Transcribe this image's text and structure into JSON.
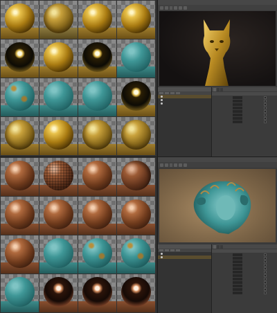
{
  "top_materials": [
    {
      "mat": "m-gold",
      "floor": "gold",
      "label": ""
    },
    {
      "mat": "m-goldr",
      "floor": "goldr",
      "label": ""
    },
    {
      "mat": "m-gold",
      "floor": "gold",
      "label": ""
    },
    {
      "mat": "m-gold",
      "floor": "gold",
      "label": ""
    },
    {
      "mat": "m-mirror",
      "floor": "gold",
      "label": ""
    },
    {
      "mat": "m-gold",
      "floor": "gold",
      "label": ""
    },
    {
      "mat": "m-mirror",
      "floor": "gold",
      "label": ""
    },
    {
      "mat": "m-teal",
      "floor": "teal",
      "label": ""
    },
    {
      "mat": "m-tealr",
      "floor": "teal",
      "label": ""
    },
    {
      "mat": "m-teal",
      "floor": "teal",
      "label": ""
    },
    {
      "mat": "m-teal",
      "floor": "teal",
      "label": ""
    },
    {
      "mat": "m-mirror",
      "floor": "gold",
      "label": ""
    },
    {
      "mat": "m-goldr",
      "floor": "gold",
      "label": ""
    },
    {
      "mat": "m-gold",
      "floor": "gold",
      "label": ""
    },
    {
      "mat": "m-goldr",
      "floor": "gold",
      "label": ""
    },
    {
      "mat": "m-goldr",
      "floor": "gold",
      "label": ""
    }
  ],
  "bottom_materials": [
    {
      "mat": "m-copper",
      "floor": "cop",
      "label": ""
    },
    {
      "mat": "m-bump",
      "floor": "cop",
      "label": ""
    },
    {
      "mat": "m-copper",
      "floor": "cop",
      "label": ""
    },
    {
      "mat": "m-copperd",
      "floor": "cop",
      "label": ""
    },
    {
      "mat": "m-copper",
      "floor": "cop",
      "label": ""
    },
    {
      "mat": "m-copper",
      "floor": "cop",
      "label": ""
    },
    {
      "mat": "m-copper",
      "floor": "cop",
      "label": ""
    },
    {
      "mat": "m-copper",
      "floor": "cop",
      "label": ""
    },
    {
      "mat": "m-copper",
      "floor": "cop",
      "label": ""
    },
    {
      "mat": "m-teal",
      "floor": "teal",
      "label": ""
    },
    {
      "mat": "m-tealr",
      "floor": "teal",
      "label": ""
    },
    {
      "mat": "m-tealr",
      "floor": "teal",
      "label": ""
    },
    {
      "mat": "m-teal",
      "floor": "teal",
      "label": ""
    },
    {
      "mat": "m-cmirror",
      "floor": "cop",
      "label": ""
    },
    {
      "mat": "m-cmirror",
      "floor": "cop",
      "label": ""
    },
    {
      "mat": "m-cmirror",
      "floor": "cop",
      "label": ""
    }
  ],
  "colors": {
    "gold": "#c9a23c",
    "copper": "#a4603a",
    "teal": "#3e9696",
    "selection": "#5a4d2e"
  },
  "top_app": {
    "menus": [
      "",
      "",
      "",
      "",
      ""
    ],
    "toolbar_select": "",
    "scene_rows": [
      {
        "label": "",
        "selected": true
      },
      {
        "label": "",
        "selected": false
      },
      {
        "label": "",
        "selected": false
      }
    ],
    "attr_tabs": [
      "",
      "",
      ""
    ],
    "section_title": "",
    "fields": [
      {
        "k": "",
        "v": "",
        "k2": ""
      },
      {
        "k": "",
        "v": "",
        "k2": ""
      },
      {
        "k": "",
        "v": "",
        "k2": ""
      },
      {
        "k": "",
        "v": "",
        "k2": ""
      },
      {
        "k": "",
        "v": "",
        "k2": ""
      },
      {
        "k": "",
        "v": "",
        "k2": ""
      },
      {
        "k": "",
        "v": "",
        "k2": ""
      },
      {
        "k": "",
        "v": "",
        "k2": ""
      }
    ]
  },
  "bottom_app": {
    "menus": [
      "",
      "",
      "",
      "",
      ""
    ],
    "toolbar_select": "",
    "caption": "",
    "scene_rows": [
      {
        "label": "",
        "selected": false
      },
      {
        "label": "",
        "selected": true
      }
    ],
    "attr_tabs": [
      "",
      "",
      ""
    ],
    "section_title": "",
    "fields": [
      {
        "k": "",
        "v": "",
        "k2": ""
      },
      {
        "k": "",
        "v": "",
        "k2": ""
      },
      {
        "k": "",
        "v": "",
        "k2": ""
      },
      {
        "k": "",
        "v": "",
        "k2": ""
      },
      {
        "k": "",
        "v": "",
        "k2": ""
      },
      {
        "k": "",
        "v": "",
        "k2": ""
      },
      {
        "k": "",
        "v": "",
        "k2": ""
      },
      {
        "k": "",
        "v": "",
        "k2": ""
      },
      {
        "k": "",
        "v": "",
        "k2": ""
      },
      {
        "k": "",
        "v": "",
        "k2": ""
      },
      {
        "k": "",
        "v": "",
        "k2": ""
      },
      {
        "k": "",
        "v": "",
        "k2": ""
      }
    ]
  }
}
